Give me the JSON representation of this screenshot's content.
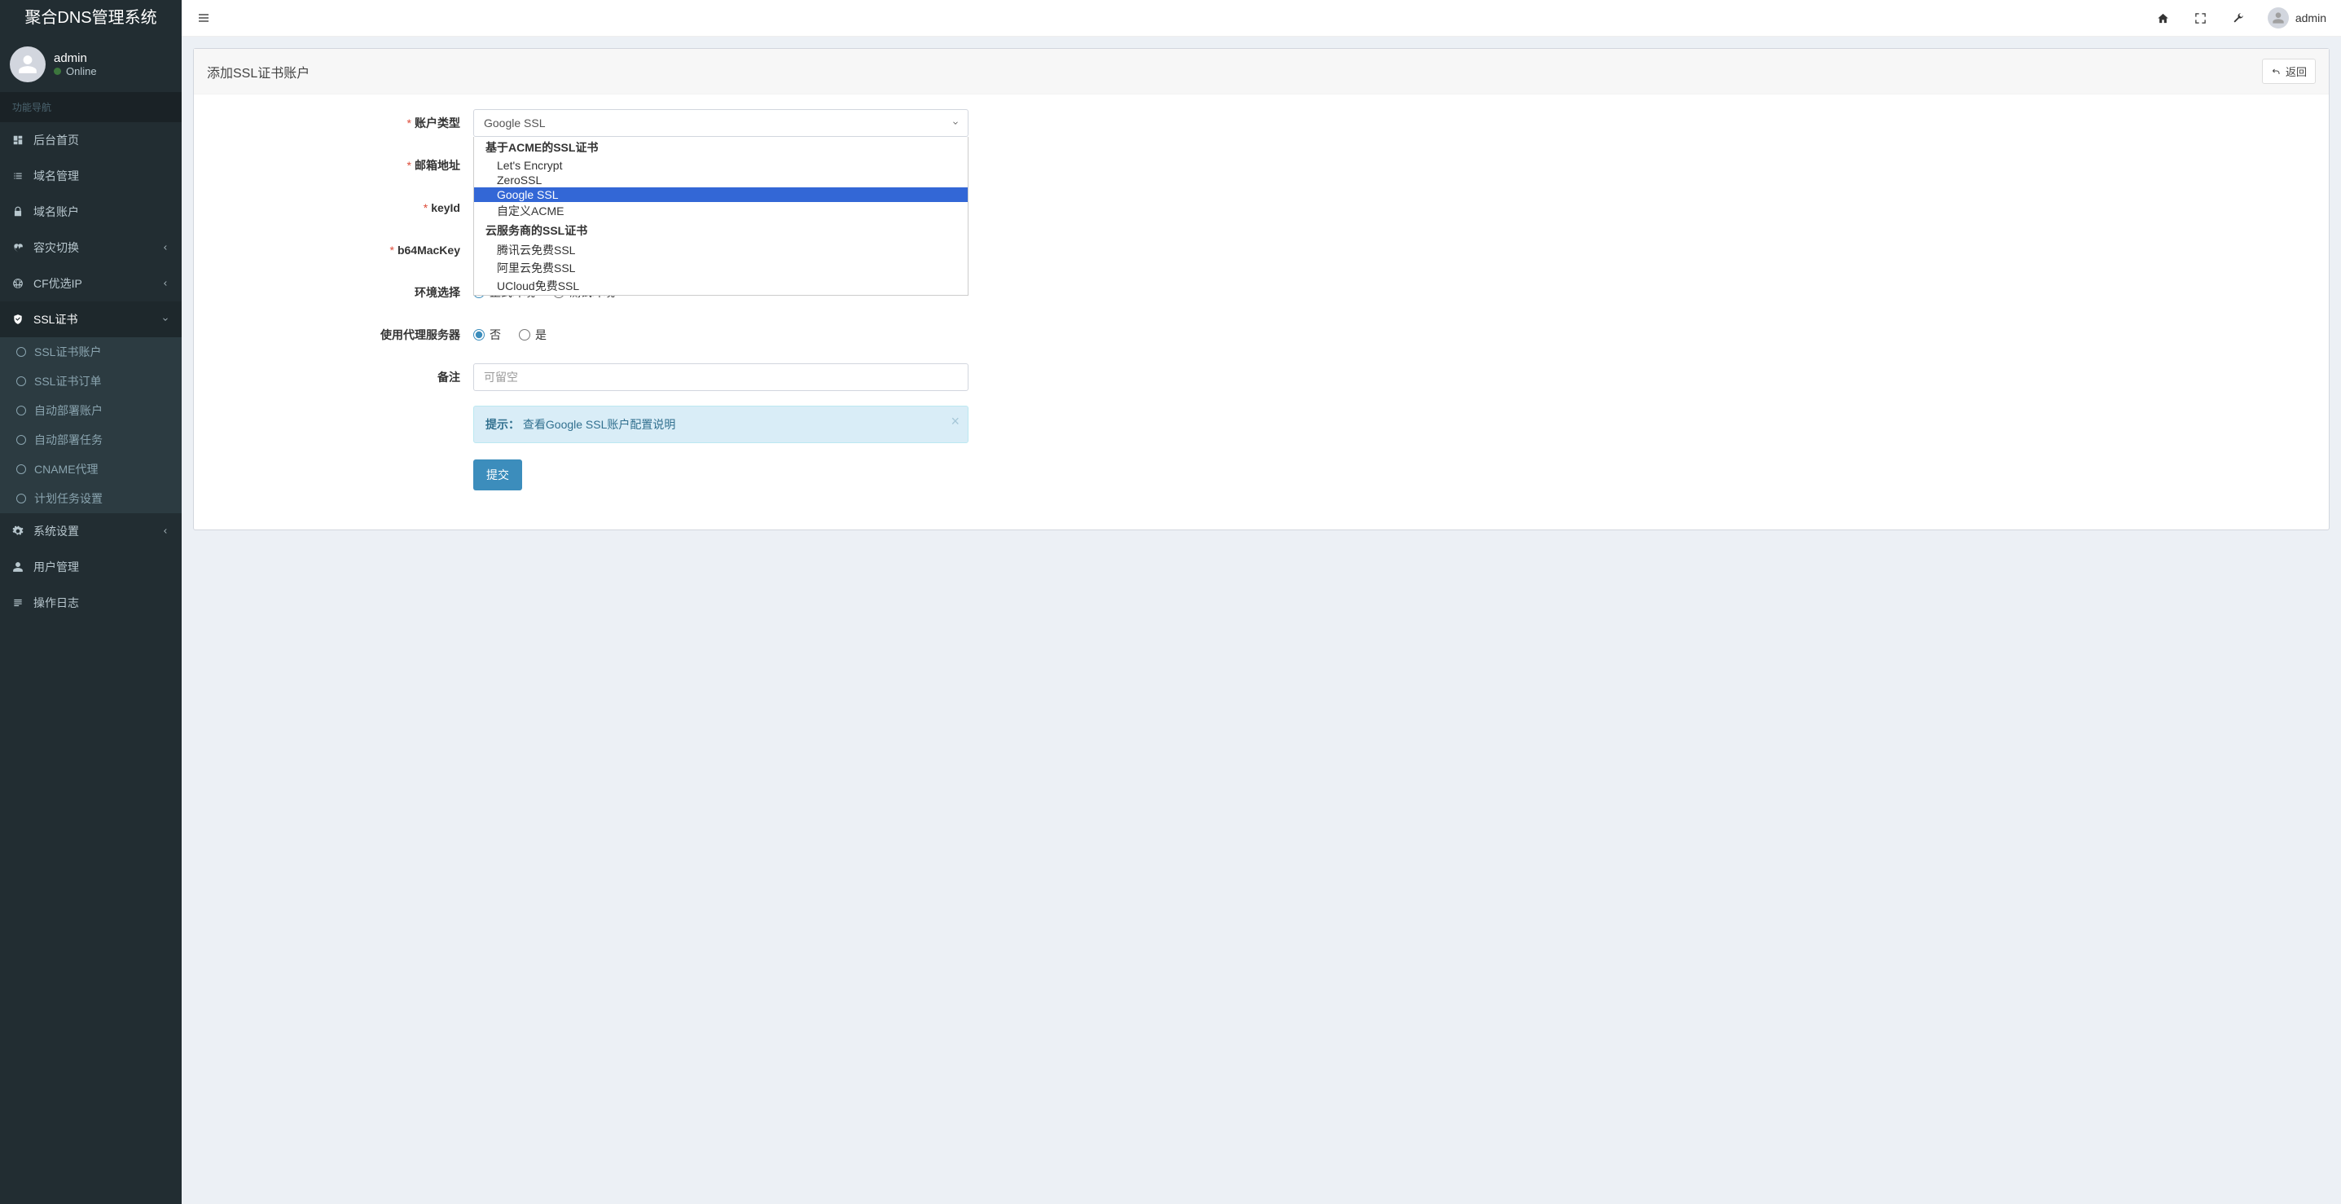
{
  "brand": "聚合DNS管理系统",
  "user": {
    "name": "admin",
    "status": "Online"
  },
  "nav_heading": "功能导航",
  "sidebar": [
    {
      "icon": "dashboard",
      "label": "后台首页",
      "type": "item"
    },
    {
      "icon": "list",
      "label": "域名管理",
      "type": "item"
    },
    {
      "icon": "lock",
      "label": "域名账户",
      "type": "item"
    },
    {
      "icon": "heartbeat",
      "label": "容灾切换",
      "type": "parent"
    },
    {
      "icon": "globe",
      "label": "CF优选IP",
      "type": "parent"
    },
    {
      "icon": "shield",
      "label": "SSL证书",
      "type": "parent",
      "open": true,
      "children": [
        "SSL证书账户",
        "SSL证书订单",
        "自动部署账户",
        "自动部署任务",
        "CNAME代理",
        "计划任务设置"
      ]
    },
    {
      "icon": "cogs",
      "label": "系统设置",
      "type": "parent"
    },
    {
      "icon": "user",
      "label": "用户管理",
      "type": "item"
    },
    {
      "icon": "loglist",
      "label": "操作日志",
      "type": "item"
    }
  ],
  "topbar": {
    "username": "admin"
  },
  "page": {
    "title": "添加SSL证书账户",
    "back_label": "返回"
  },
  "form": {
    "account_type": {
      "label": "账户类型",
      "value": "Google SSL"
    },
    "email": {
      "label": "邮箱地址"
    },
    "keyid": {
      "label": "keyId"
    },
    "b64mackey": {
      "label": "b64MacKey"
    },
    "env": {
      "label": "环境选择",
      "options": [
        "正式环境",
        "测试环境"
      ],
      "selected": 0
    },
    "proxy": {
      "label": "使用代理服务器",
      "options": [
        "否",
        "是"
      ],
      "selected": 0
    },
    "remark": {
      "label": "备注",
      "placeholder": "可留空"
    },
    "hint": {
      "prefix": "提示：",
      "link": "查看Google SSL账户配置说明"
    },
    "submit": "提交"
  },
  "dropdown": {
    "groups": [
      {
        "label": "基于ACME的SSL证书",
        "options": [
          "Let's Encrypt",
          "ZeroSSL",
          "Google SSL",
          "自定义ACME"
        ]
      },
      {
        "label": "云服务商的SSL证书",
        "options": [
          "腾讯云免费SSL",
          "阿里云免费SSL",
          "UCloud免费SSL"
        ]
      }
    ],
    "selected": "Google SSL"
  }
}
